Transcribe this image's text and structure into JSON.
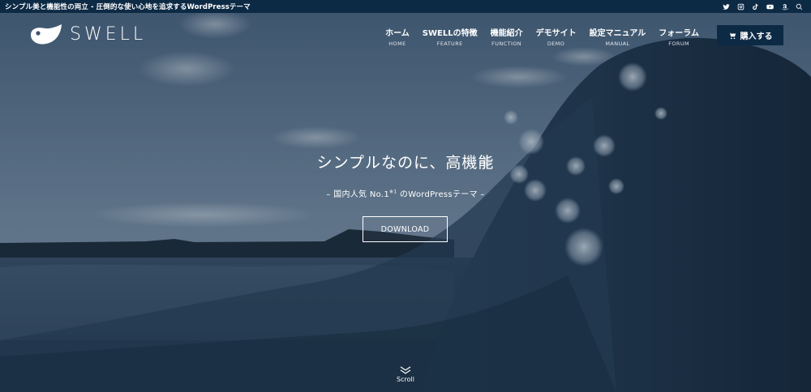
{
  "topbar": {
    "tagline": "シンプル美と機能性の両立 - 圧倒的な使い心地を追求するWordPressテーマ",
    "social_icons": [
      "twitter-icon",
      "instagram-icon",
      "tiktok-icon",
      "youtube-icon",
      "amazon-icon",
      "search-icon"
    ]
  },
  "header": {
    "logo_text": "SWELL",
    "nav": [
      {
        "jp": "ホーム",
        "en": "HOME"
      },
      {
        "jp": "SWELLの特徴",
        "en": "FEATURE"
      },
      {
        "jp": "機能紹介",
        "en": "FUNCTION"
      },
      {
        "jp": "デモサイト",
        "en": "DEMO"
      },
      {
        "jp": "設定マニュアル",
        "en": "MANUAL"
      },
      {
        "jp": "フォーラム",
        "en": "FORUM"
      }
    ],
    "buy_label": "購入する"
  },
  "hero": {
    "title": "シンプルなのに、高機能",
    "subtitle_pre": "– 国内人気 No.1",
    "subtitle_sup": "※1",
    "subtitle_post": " のWordPressテーマ –",
    "download_label": "DOWNLOAD",
    "scroll_label": "Scroll"
  },
  "colors": {
    "bar_bg": "#0d2a45",
    "sky": "#5f7891",
    "sea": "#2a4157"
  }
}
